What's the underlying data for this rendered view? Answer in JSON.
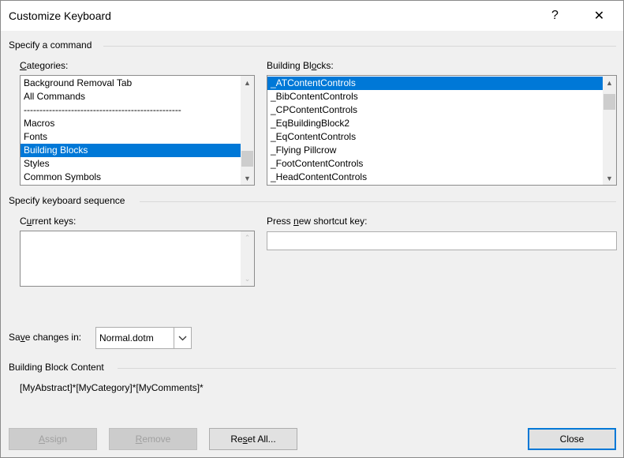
{
  "dialog": {
    "title": "Customize Keyboard",
    "help_glyph": "?",
    "close_glyph": "✕"
  },
  "specify_command": {
    "header": "Specify a command",
    "categories_label_prefix": "",
    "categories_label_u": "C",
    "categories_label_rest": "ategories:",
    "categories": [
      "Background Removal Tab",
      "All Commands",
      "--------------------------------------------------",
      "Macros",
      "Fonts",
      "Building Blocks",
      "Styles",
      "Common Symbols"
    ],
    "categories_selected": "Building Blocks",
    "blocks_label_prefix": "Building Bl",
    "blocks_label_u": "o",
    "blocks_label_rest": "cks:",
    "blocks": [
      "_ATContentControls",
      "_BibContentControls",
      "_CPContentControls",
      "_EqBuildingBlock2",
      "_EqContentControls",
      "_Flying Pillcrow",
      "_FootContentControls",
      "_HeadContentControls"
    ],
    "blocks_selected": "_ATContentControls"
  },
  "keyboard_sequence": {
    "header": "Specify keyboard sequence",
    "current_keys_label_prefix": "C",
    "current_keys_label_u": "u",
    "current_keys_label_rest": "rrent keys:",
    "current_keys": [],
    "new_key_label_prefix": "Press ",
    "new_key_label_u": "n",
    "new_key_label_rest": "ew shortcut key:",
    "new_key_value": ""
  },
  "save_changes": {
    "label_prefix": "Sa",
    "label_u": "v",
    "label_rest": "e changes in:",
    "selected": "Normal.dotm"
  },
  "content": {
    "header": "Building Block Content",
    "text": "[MyAbstract]*[MyCategory]*[MyComments]*"
  },
  "buttons": {
    "assign_u": "A",
    "assign_rest": "ssign",
    "remove_u": "R",
    "remove_rest": "emove",
    "reset_prefix": "Re",
    "reset_u": "s",
    "reset_rest": "et All...",
    "close": "Close"
  }
}
